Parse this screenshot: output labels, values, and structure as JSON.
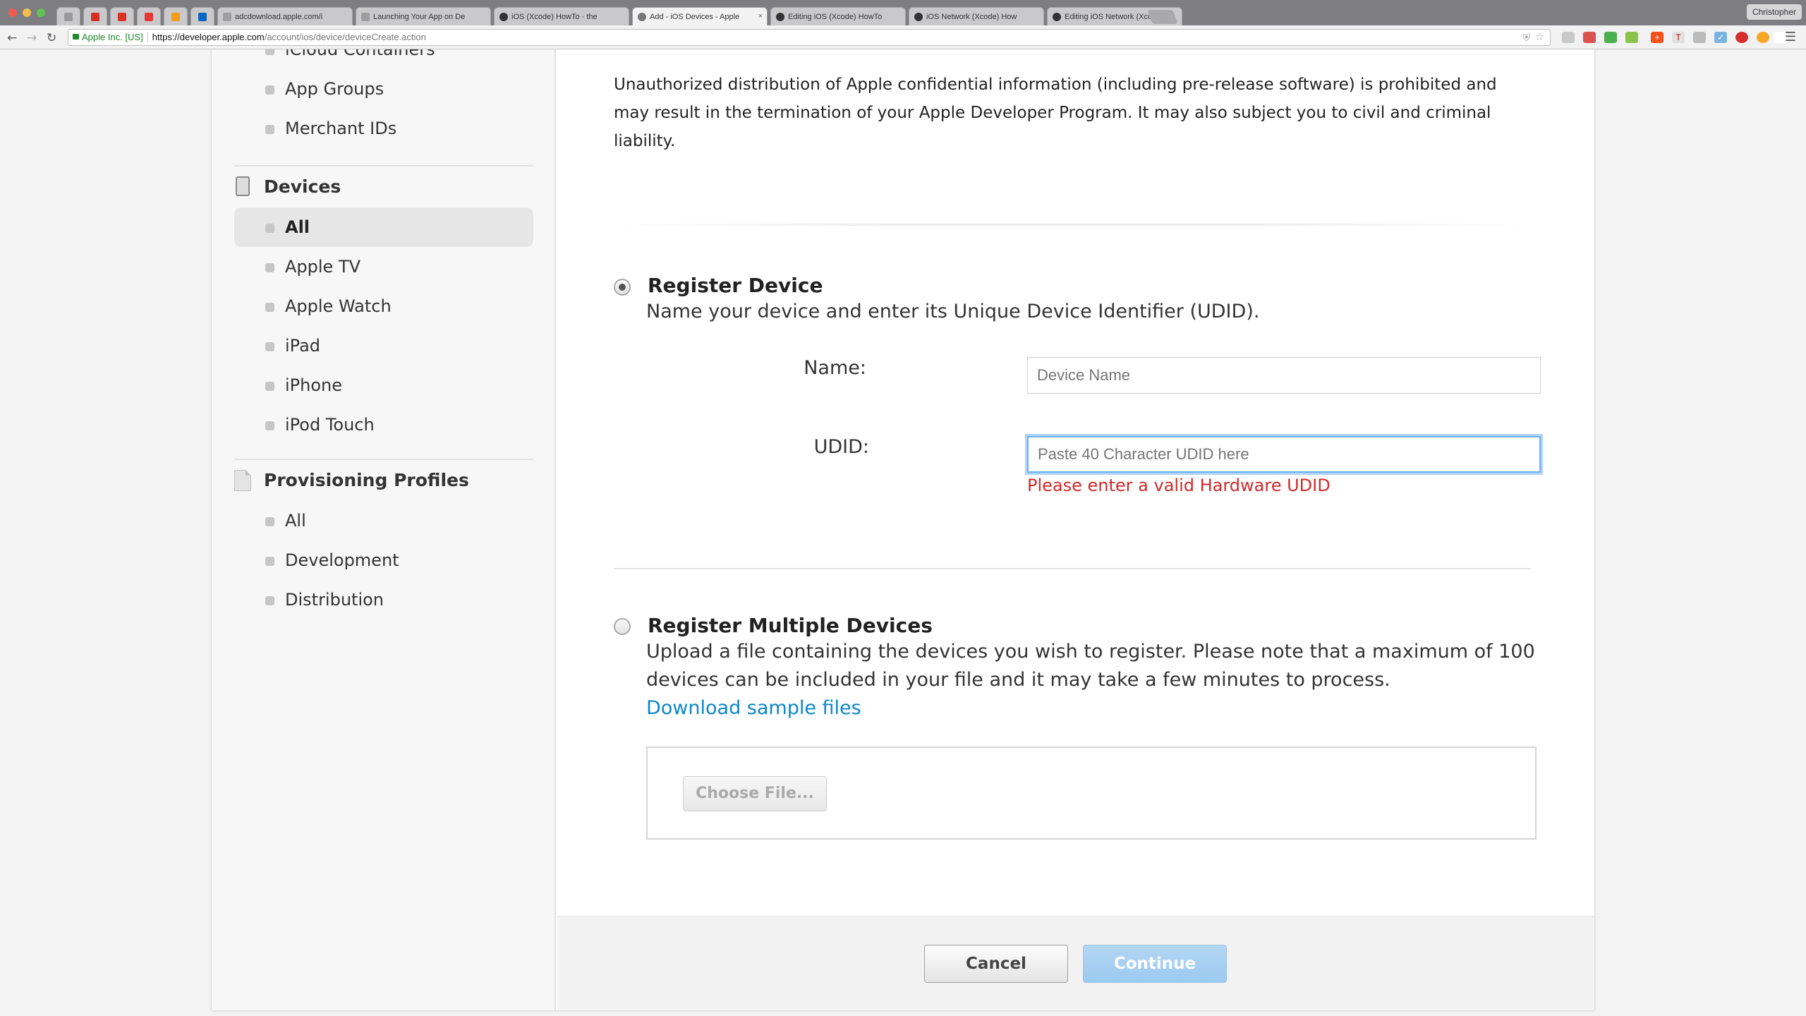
{
  "browser": {
    "tabs": [
      {
        "title": "",
        "icon": "close-tab-icon",
        "pinned": true
      },
      {
        "title": "",
        "icon": "gmail-icon",
        "pinned": true
      },
      {
        "title": "",
        "icon": "gmail-icon",
        "pinned": true
      },
      {
        "title": "",
        "icon": "app-icon",
        "pinned": true
      },
      {
        "title": "",
        "icon": "play-icon",
        "pinned": true
      },
      {
        "title": "",
        "icon": "linkedin-icon",
        "pinned": true
      },
      {
        "title": "adcdownload.apple.com/i",
        "icon": "page-icon"
      },
      {
        "title": "Launching Your App on De",
        "icon": "page-icon"
      },
      {
        "title": "iOS (Xcode) HowTo · the",
        "icon": "github-icon"
      },
      {
        "title": "Add - iOS Devices - Apple",
        "icon": "apple-icon",
        "active": true
      },
      {
        "title": "Editing iOS (Xcode) HowTo",
        "icon": "github-icon"
      },
      {
        "title": "iOS Network (Xcode) How",
        "icon": "github-icon"
      },
      {
        "title": "Editing iOS Network (Xcod",
        "icon": "github-icon"
      }
    ],
    "profile_name": "Christopher",
    "ev_label": "Apple Inc. [US]",
    "url_scheme_host": "https://developer.apple.com",
    "url_path": "/account/ios/device/deviceCreate.action",
    "colors": {
      "ev_green": "#1e8a2c",
      "link_blue": "#0b87c9",
      "error_red": "#cf2a2a"
    }
  },
  "sidebar": {
    "top_items": [
      "iCloud Containers",
      "App Groups",
      "Merchant IDs"
    ],
    "devices": {
      "heading": "Devices",
      "items": [
        "All",
        "Apple TV",
        "Apple Watch",
        "iPad",
        "iPhone",
        "iPod Touch"
      ],
      "active": "All"
    },
    "profiles": {
      "heading": "Provisioning Profiles",
      "items": [
        "All",
        "Development",
        "Distribution"
      ]
    }
  },
  "main": {
    "notice": "Unauthorized distribution of Apple confidential information (including pre-release software) is prohibited and may result in the termination of your Apple Developer Program. It may also subject you to civil and criminal liability.",
    "register_device": {
      "title": "Register Device",
      "description": "Name your device and enter its Unique Device Identifier (UDID).",
      "selected": true,
      "name_label": "Name:",
      "name_placeholder": "Device Name",
      "udid_label": "UDID:",
      "udid_placeholder": "Paste 40 Character UDID here",
      "error": "Please enter a valid Hardware UDID"
    },
    "register_multiple": {
      "title": "Register Multiple Devices",
      "description": "Upload a file containing the devices you wish to register. Please note that a maximum of 100 devices can be included in your file and it may take a few minutes to process.",
      "link": "Download sample files",
      "choose_file": "Choose File..."
    },
    "footer": {
      "cancel": "Cancel",
      "continue": "Continue"
    }
  }
}
